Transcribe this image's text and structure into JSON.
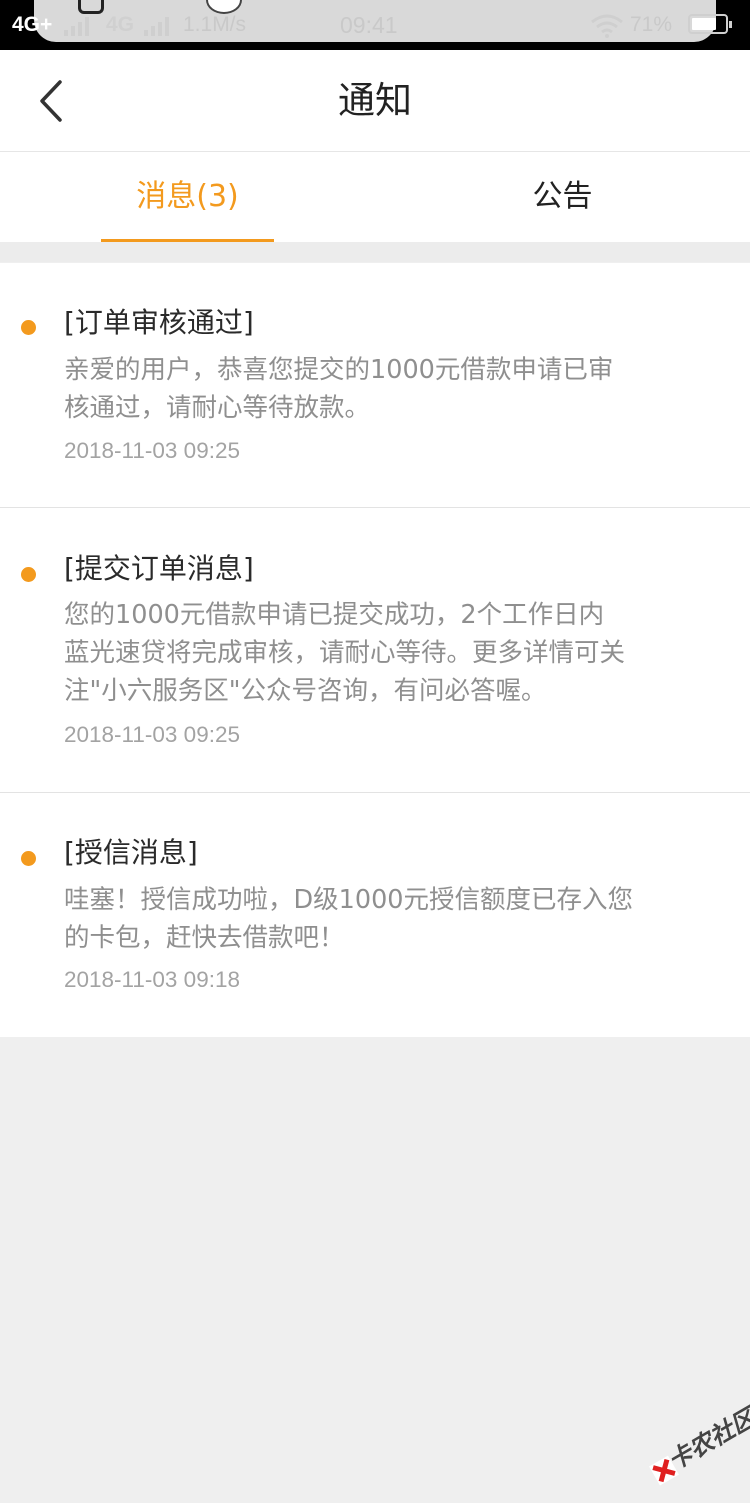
{
  "status_bar": {
    "network_1": "4G+",
    "network_2": "4G",
    "speed": "1.1M/s",
    "time": "09:41",
    "battery": "71%",
    "icons": [
      "bell-icon",
      "signal-icon",
      "wifi-icon",
      "battery-icon"
    ]
  },
  "header": {
    "title": "通知",
    "back_icon": "chevron-left-icon"
  },
  "tabs": [
    {
      "label": "消息(3)",
      "active": true
    },
    {
      "label": "公告",
      "active": false
    }
  ],
  "colors": {
    "accent": "#f39a1e",
    "text_primary": "#2a2a2a",
    "text_secondary": "#8f8f8f",
    "background": "#efefef"
  },
  "messages": [
    {
      "title": "[订单审核通过]",
      "lines": [
        "亲爱的用户，恭喜您提交的1000元借款申请已审",
        "核通过，请耐心等待放款。"
      ],
      "time": "2018-11-03 09:25"
    },
    {
      "title": "[提交订单消息]",
      "lines": [
        "您的1000元借款申请已提交成功，2个工作日内",
        "蓝光速贷将完成审核，请耐心等待。更多详情可关",
        "注\"小六服务区\"公众号咨询，有问必答喔。"
      ],
      "time": "2018-11-03 09:25"
    },
    {
      "title": "[授信消息]",
      "lines": [
        "哇塞！授信成功啦，D级1000元授信额度已存入您",
        "的卡包，赶快去借款吧！"
      ],
      "time": "2018-11-03 09:18"
    }
  ],
  "watermark": {
    "text": "卡农社区",
    "icon": "watermark-logo-icon"
  }
}
